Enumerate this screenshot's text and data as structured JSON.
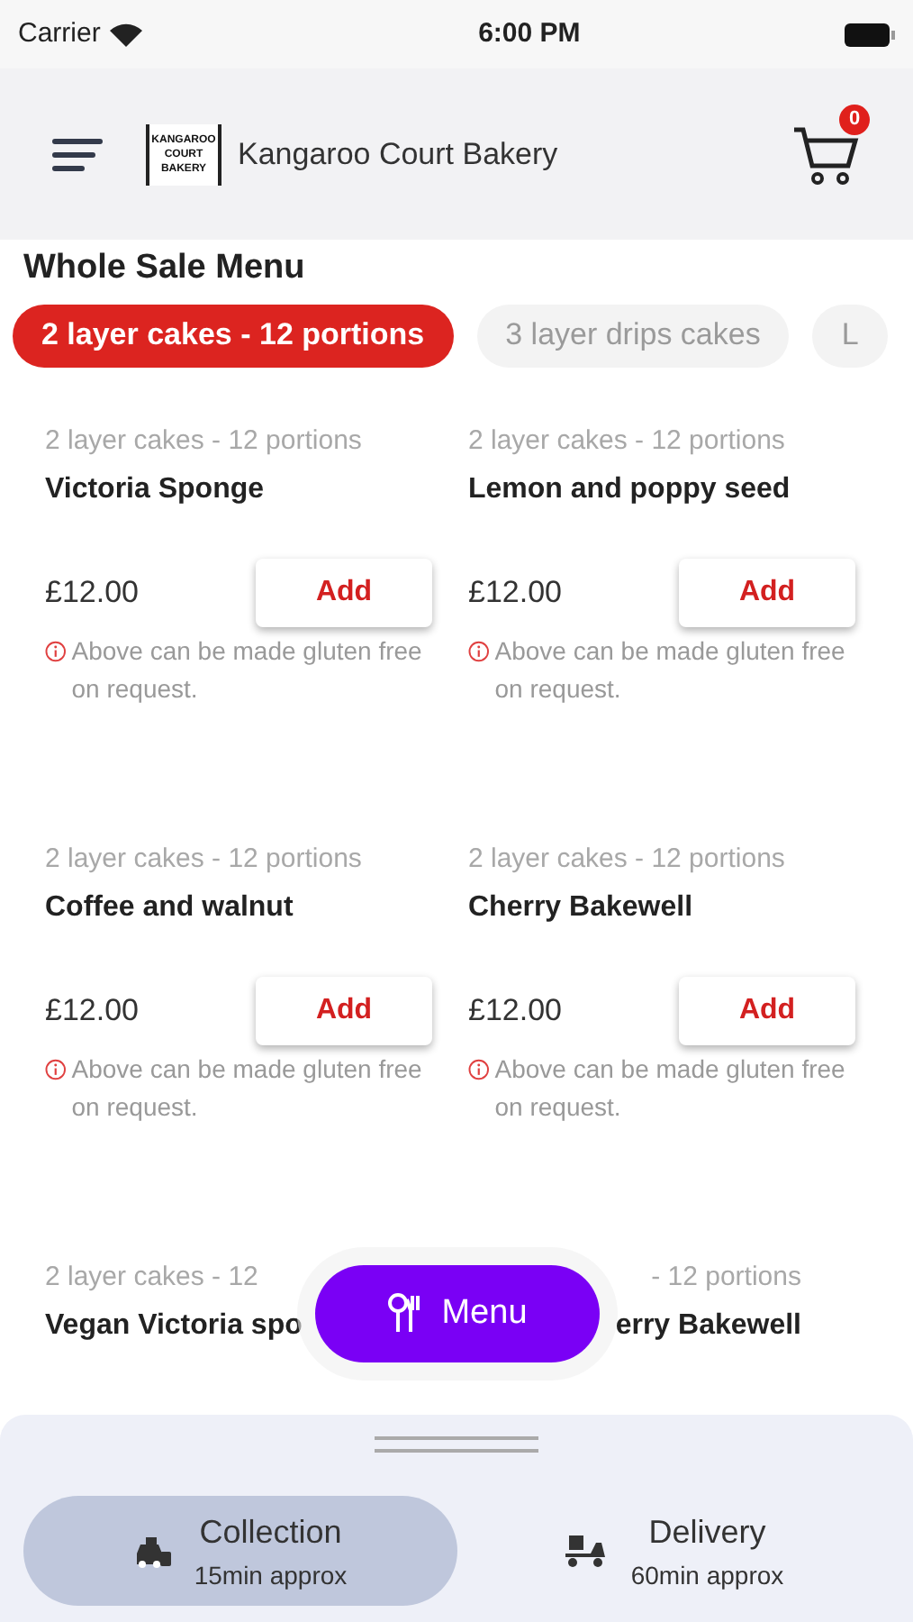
{
  "status_bar": {
    "carrier": "Carrier",
    "time": "6:00 PM"
  },
  "header": {
    "title": "Kangaroo Court Bakery",
    "logo_lines": [
      "KANGAROO",
      "COURT",
      "BAKERY"
    ],
    "cart_count": "0"
  },
  "section_title": "Whole Sale Menu",
  "tabs": [
    {
      "label": "2 layer cakes - 12 portions",
      "selected": true
    },
    {
      "label": "3 layer drips cakes",
      "selected": false
    },
    {
      "label": "L",
      "selected": false
    }
  ],
  "products": [
    {
      "category": "2 layer cakes - 12 portions",
      "name": "Victoria Sponge",
      "price": "£12.00",
      "button": "Add",
      "note": "Above can be made gluten free on request."
    },
    {
      "category": "2 layer cakes - 12 portions",
      "name": "Lemon and poppy seed",
      "price": "£12.00",
      "button": "Add",
      "note": "Above can be made gluten free on request."
    },
    {
      "category": "2 layer cakes - 12 portions",
      "name": "Coffee and walnut",
      "price": "£12.00",
      "button": "Add",
      "note": "Above can be made gluten free on request."
    },
    {
      "category": "2 layer cakes - 12 portions",
      "name": "Cherry Bakewell",
      "price": "£12.00",
      "button": "Add",
      "note": "Above can be made gluten free on request."
    },
    {
      "kind": "covered_left",
      "category": "2 layer cakes - 12",
      "name": "Vegan Victoria spo"
    },
    {
      "kind": "covered_right",
      "category": "- 12 portions",
      "name": "erry Bakewell"
    }
  ],
  "menu_button": "Menu",
  "order_types": [
    {
      "kind": "collection",
      "label": "Collection",
      "time": "15min approx",
      "selected": true
    },
    {
      "kind": "delivery",
      "label": "Delivery",
      "time": "60min approx",
      "selected": false
    }
  ]
}
